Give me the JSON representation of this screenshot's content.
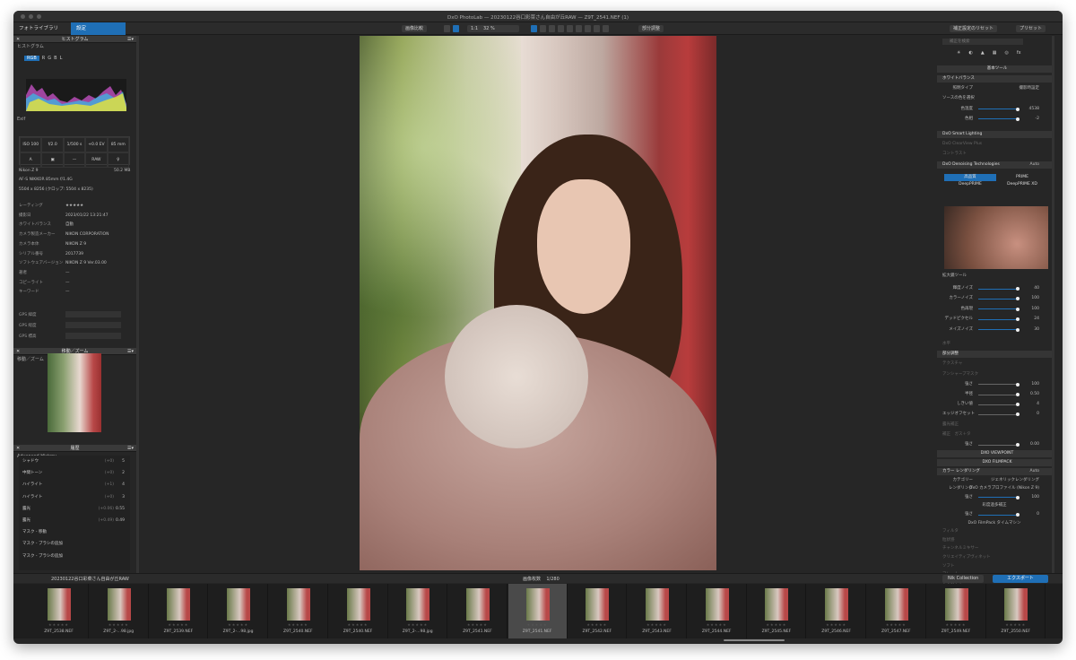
{
  "window": {
    "title": "DxO PhotoLab — 20230122谷口彩菜さん自由が丘RAW — Z9T_2541.NEF (1)"
  },
  "tabs": {
    "library": "フォトライブラリ",
    "settings": "設定"
  },
  "toolbar": {
    "compare": "画像比較",
    "zoom_fit": "1:1",
    "zoom": "32 %",
    "partial": "部分調整",
    "reset": "補正設定のリセット",
    "preset": "プリセット"
  },
  "left": {
    "histogram_title": "ヒストグラム",
    "histogram_sub": "ヒストグラム",
    "channels": [
      "RGB",
      "R",
      "G",
      "B",
      "L"
    ],
    "exif_title": "Exif",
    "exif_cells": [
      "ISO 100",
      "f/2.0",
      "1/500 s",
      "+0.0 EV",
      "85 mm",
      "A",
      "▣",
      "—",
      "RAW",
      "♀"
    ],
    "camera": "Nikon Z 9",
    "size": "50.2 MB",
    "lens": "AF-S NIKKOR 85mm f/1.4G",
    "dims": "5504 x 8256 (クロップ: 5504 x 8235)",
    "meta": [
      {
        "k": "レーティング",
        "v": "★★★★★"
      },
      {
        "k": "撮影日",
        "v": "2023/01/22 13:21:47"
      },
      {
        "k": "ホワイトバランス",
        "v": "自動"
      },
      {
        "k": "カメラ製造メーカー",
        "v": "NIKON CORPORATION"
      },
      {
        "k": "カメラ本体",
        "v": "NIKON Z 9"
      },
      {
        "k": "シリアル番号",
        "v": "2017739"
      },
      {
        "k": "ソフトウェアバージョン",
        "v": "NIKON Z 9 Ver.03.00"
      },
      {
        "k": "著者",
        "v": "—"
      },
      {
        "k": "コピーライト",
        "v": "—"
      },
      {
        "k": "キーワード",
        "v": "—"
      }
    ],
    "gps": [
      "GPS 緯度",
      "GPS 経度",
      "GPS 標高"
    ],
    "nav_title": "移動／ズーム",
    "nav_sub": "移動／ズーム",
    "history_title": "履歴",
    "history_sub": "Advanced History",
    "history": [
      {
        "k": "シャドウ",
        "d": "(+0)",
        "v": "5"
      },
      {
        "k": "中間トーン",
        "d": "(+0)",
        "v": "2"
      },
      {
        "k": "ハイライト",
        "d": "(+1)",
        "v": "4"
      },
      {
        "k": "ハイライト",
        "d": "(+0)",
        "v": "3"
      },
      {
        "k": "露光",
        "d": "(+0.06)",
        "v": "0.55"
      },
      {
        "k": "露光",
        "d": "(+0.49)",
        "v": "0.49"
      },
      {
        "k": "マスク - 移動",
        "d": "",
        "v": ""
      },
      {
        "k": "マスク - ブラシの追加",
        "d": "",
        "v": ""
      },
      {
        "k": "マスク - ブラシの追加",
        "d": "",
        "v": ""
      }
    ]
  },
  "right": {
    "search_placeholder": "補正を検索",
    "basic_title": "基本ツール",
    "rows": [
      {
        "t": "hd",
        "l": "ホワイトバランス",
        "v": ""
      },
      {
        "t": "kv",
        "l": "照明タイプ",
        "v": "撮影時設定"
      },
      {
        "t": "kv",
        "l": "ソースの色を選択",
        "v": ""
      },
      {
        "t": "sl",
        "l": "色温度",
        "v": "4538"
      },
      {
        "t": "sl",
        "l": "色相",
        "v": "-2"
      },
      {
        "t": "gap",
        "l": "",
        "v": ""
      },
      {
        "t": "hd",
        "l": "DxO Smart Lighting",
        "v": ""
      },
      {
        "t": "dim",
        "l": "DxO ClearView Plus",
        "v": ""
      },
      {
        "t": "dim",
        "l": "コントラスト",
        "v": ""
      },
      {
        "t": "hd",
        "l": "DxO Denoising Technologies",
        "v": "Auto"
      }
    ],
    "denoise_tabs": [
      "高品質",
      "PRIME",
      "DeepPRIME",
      "DeepPRIME XD"
    ],
    "loupe": "拡大鏡ツール",
    "noise": [
      {
        "l": "輝度ノイズ",
        "v": "40"
      },
      {
        "l": "カラーノイズ",
        "v": "100"
      },
      {
        "l": "色再現",
        "v": "100"
      },
      {
        "l": "デッドピクセル",
        "v": "24"
      },
      {
        "l": "メイズノイズ",
        "v": "30"
      }
    ],
    "more": [
      {
        "t": "dim",
        "l": "水平",
        "v": ""
      },
      {
        "t": "hd",
        "l": "部分調整",
        "v": ""
      },
      {
        "t": "dim",
        "l": "テクスチャ",
        "v": ""
      },
      {
        "t": "dim",
        "l": "アンシャープマスク",
        "v": ""
      },
      {
        "t": "sld",
        "l": "強さ",
        "v": "100"
      },
      {
        "t": "sld",
        "l": "半径",
        "v": "0.50"
      },
      {
        "t": "sld",
        "l": "しきい値",
        "v": "4"
      },
      {
        "t": "sld",
        "l": "エッジオフセット",
        "v": "0"
      },
      {
        "t": "dim",
        "l": "露光補正",
        "v": ""
      },
      {
        "t": "dim",
        "l": "補正　ガス＋タ",
        "v": ""
      },
      {
        "t": "sld",
        "l": "強さ",
        "v": "0.00"
      }
    ],
    "viewpoint": "DXO VIEWPOINT",
    "filmpack": "DXO FILMPACK",
    "film_rows": [
      {
        "t": "hd",
        "l": "カラー レンダリング",
        "v": "Auto"
      },
      {
        "t": "kv",
        "l": "カテゴリー",
        "v": "ジェネリックレンダリング"
      },
      {
        "t": "kv",
        "l": "レンダリング",
        "v": "DxO カメラプロファイル (Nikon Z 9)"
      },
      {
        "t": "sl",
        "l": "強さ",
        "v": "100"
      },
      {
        "t": "ctr",
        "l": "彩度過多補正",
        "v": ""
      },
      {
        "t": "sl",
        "l": "強さ",
        "v": "0"
      },
      {
        "t": "ctr",
        "l": "DxO FilmPack タイムマシン",
        "v": ""
      },
      {
        "t": "dim",
        "l": "フィルタ",
        "v": ""
      },
      {
        "t": "dim",
        "l": "粒状感",
        "v": ""
      },
      {
        "t": "dim",
        "l": "チャンネルミキサー",
        "v": ""
      },
      {
        "t": "dim",
        "l": "クリエイティブヴィネット",
        "v": ""
      },
      {
        "t": "dim",
        "l": "ソフト",
        "v": ""
      },
      {
        "t": "dim",
        "l": "フレーム",
        "v": ""
      },
      {
        "t": "dim",
        "l": "テクスチャ",
        "v": ""
      }
    ]
  },
  "filmstrip": {
    "folder": "20230122谷口彩菜さん自由が丘RAW",
    "count_label": "画像枚数",
    "count": "1/280",
    "nik": "Nik Collection",
    "export": "エクスポート",
    "items": [
      "Z9T_2538.NEF",
      "Z9T_2-...98.jpg",
      "Z9T_2539.NEF",
      "Z9T_2-...98.jpg",
      "Z9T_2540.NEF",
      "Z9T_2540.NEF",
      "Z9T_2-...98.jpg",
      "Z9T_2541.NEF",
      "Z9T_2541.NEF",
      "Z9T_2542.NEF",
      "Z9T_2543.NEF",
      "Z9T_2544.NEF",
      "Z9T_2545.NEF",
      "Z9T_2546.NEF",
      "Z9T_2547.NEF",
      "Z9T_2549.NEF",
      "Z9T_2550.NEF"
    ],
    "selected": 8
  }
}
